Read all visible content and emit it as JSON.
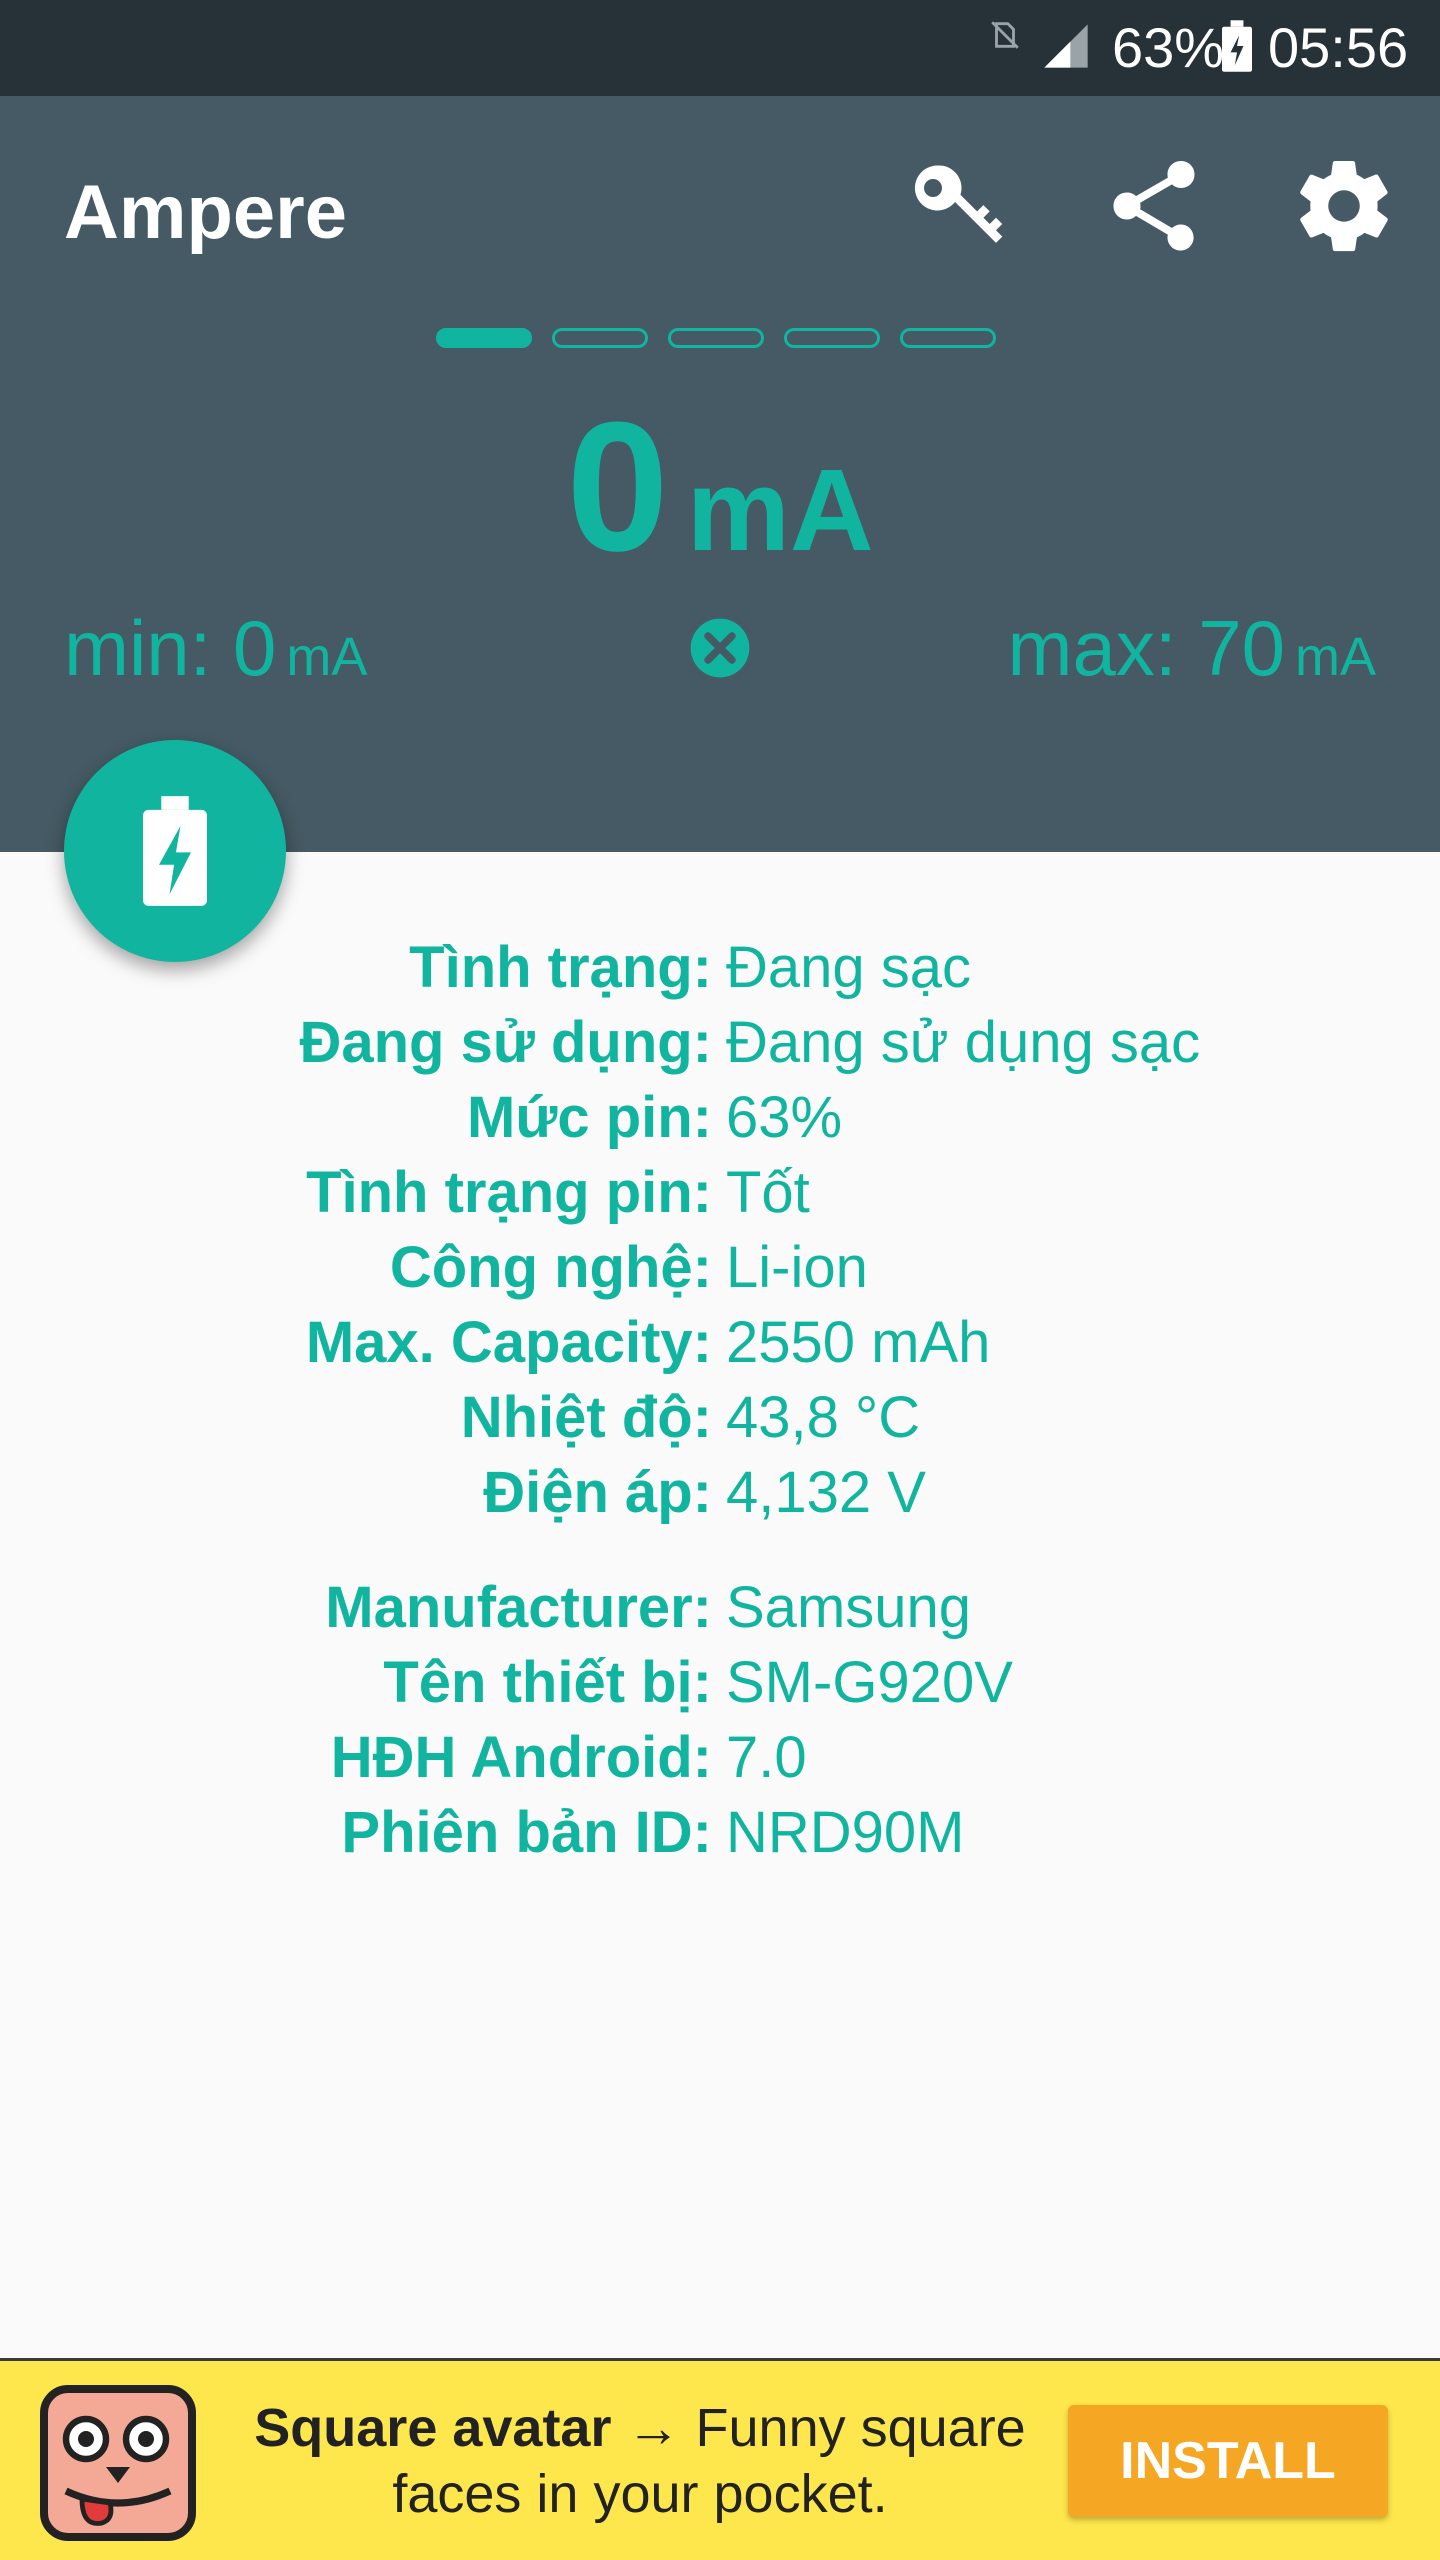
{
  "status_bar": {
    "battery_percent": "63%",
    "time": "05:56",
    "icons": [
      "no-sim-icon",
      "signal-icon",
      "battery-charging-icon"
    ]
  },
  "header": {
    "app_title": "Ampere",
    "actions": [
      "key-icon",
      "share-icon",
      "gear-icon"
    ],
    "page_indicator": {
      "count": 5,
      "active": 0
    },
    "current": {
      "value": "0",
      "unit": "mA"
    },
    "min": {
      "label": "min: 0",
      "unit": "mA"
    },
    "max": {
      "label": "max: 70",
      "unit": "mA"
    }
  },
  "info": {
    "battery": [
      {
        "label": "Tình trạng:",
        "value": "Đang sạc"
      },
      {
        "label": "Đang sử dụng:",
        "value": "Đang sử dụng sạc"
      },
      {
        "label": "Mức pin:",
        "value": "63%"
      },
      {
        "label": "Tình trạng pin:",
        "value": "Tốt"
      },
      {
        "label": "Công nghệ:",
        "value": "Li-ion"
      },
      {
        "label": "Max. Capacity:",
        "value": "2550 mAh"
      },
      {
        "label": "Nhiệt độ:",
        "value": "43,8 °C"
      },
      {
        "label": "Điện áp:",
        "value": "4,132 V"
      }
    ],
    "device": [
      {
        "label": "Manufacturer:",
        "value": "Samsung"
      },
      {
        "label": "Tên thiết bị:",
        "value": "SM-G920V"
      },
      {
        "label": "HĐH Android:",
        "value": "7.0"
      },
      {
        "label": "Phiên bản ID:",
        "value": "NRD90M"
      }
    ]
  },
  "ad": {
    "title": "Square avatar",
    "arrow": "→",
    "line1": "Funny square",
    "line2": "faces in your pocket.",
    "install_label": "INSTALL"
  },
  "colors": {
    "accent": "#11b59f",
    "header_bg": "#455a64",
    "status_bg": "#263238",
    "ad_bg": "#fde74c",
    "install_bg": "#f5a623"
  }
}
